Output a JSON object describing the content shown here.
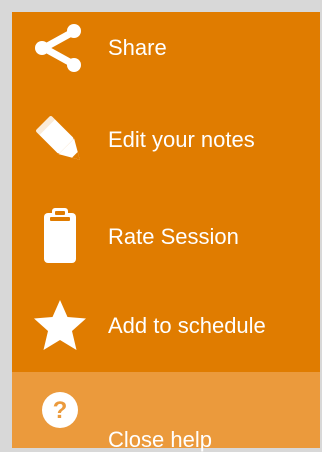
{
  "menu": {
    "items": [
      {
        "label": "Share",
        "icon": "share-icon"
      },
      {
        "label": "Edit your notes",
        "icon": "pencil-icon"
      },
      {
        "label": "Rate Session",
        "icon": "clipboard-icon"
      },
      {
        "label": "Add to schedule",
        "icon": "star-icon"
      }
    ]
  },
  "help": {
    "label": "Close help",
    "icon": "help-circle-icon"
  },
  "colors": {
    "menu_background": "#e07c00",
    "help_background": "#eb9a3c",
    "page_background": "#d8d8d8",
    "foreground": "#ffffff"
  }
}
